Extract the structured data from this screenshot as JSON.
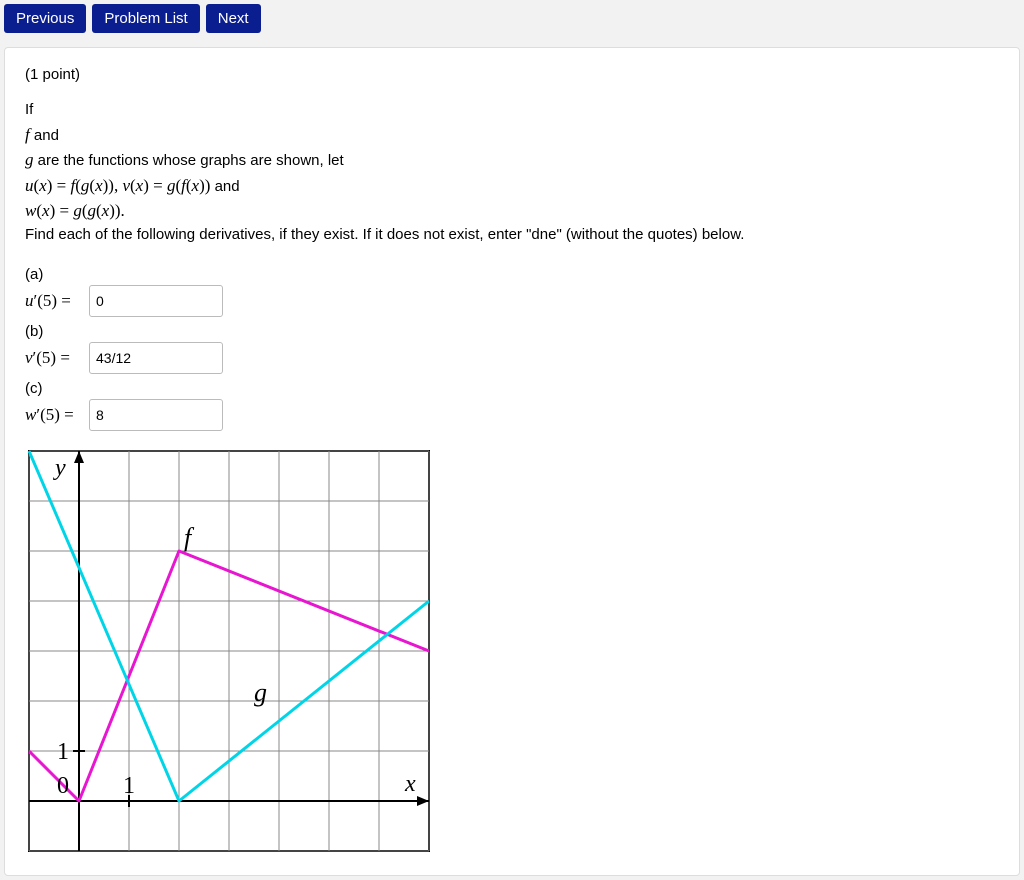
{
  "nav": {
    "previous": "Previous",
    "problem_list": "Problem List",
    "next": "Next"
  },
  "points_label": "(1 point)",
  "problem": {
    "if_text": "If",
    "f_and": " and",
    "g_are": " are the functions whose graphs are shown, let",
    "line2_pre": "u(x) = f(g(x)), v(x) = g(f(x)),",
    "line2_and": " and",
    "line3": "w(x) = g(g(x)).",
    "instructions": "Find each of the following derivatives, if they exist. If it does not exist, enter \"dne\" (without the quotes) below."
  },
  "parts": {
    "a": {
      "letter": "(a)",
      "lhs": "u′(5) =",
      "value": "0"
    },
    "b": {
      "letter": "(b)",
      "lhs": "v′(5) =",
      "value": "43/12"
    },
    "c": {
      "letter": "(c)",
      "lhs": "w′(5) =",
      "value": "8"
    }
  },
  "chart_data": {
    "type": "line",
    "xlim": [
      -1,
      7
    ],
    "ylim": [
      -1,
      7
    ],
    "grid_step": 1,
    "x_tick_label": "1",
    "y_tick_label": "1",
    "origin_label": "0",
    "x_axis_label": "x",
    "y_axis_label": "y",
    "series": [
      {
        "name": "f",
        "color": "#e815d1",
        "points": [
          [
            -1,
            1
          ],
          [
            0,
            0
          ],
          [
            2,
            5
          ],
          [
            7,
            3
          ]
        ]
      },
      {
        "name": "g",
        "color": "#00d5e8",
        "points": [
          [
            -1,
            7
          ],
          [
            2,
            0
          ],
          [
            7,
            4
          ]
        ]
      }
    ],
    "series_labels": {
      "f_label_pos": [
        2.1,
        5.1
      ],
      "g_label_pos": [
        3.5,
        2.0
      ]
    }
  }
}
